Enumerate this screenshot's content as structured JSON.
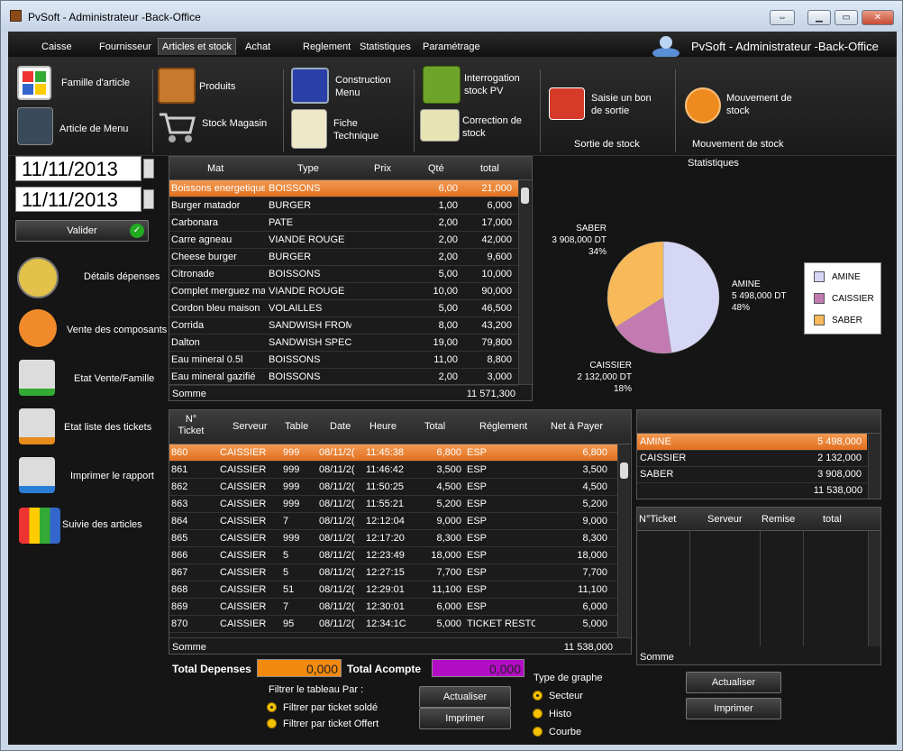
{
  "window": {
    "title": "PvSoft - Administrateur -Back-Office",
    "header_user": "PvSoft - Administrateur -Back-Office"
  },
  "menu": [
    "Caisse",
    "Fournisseur",
    "Articles et stock",
    "Achat",
    "Reglement",
    "Statistiques",
    "Paramétrage"
  ],
  "ribbon": {
    "famille": "Famille d'article",
    "article_menu": "Article de Menu",
    "produits": "Produits",
    "stock_magasin": "Stock Magasin",
    "construction_l1": "Construction",
    "construction_l2": "Menu",
    "fiche_l1": "Fiche",
    "fiche_l2": "Technique",
    "interrogation_l1": "Interrogation",
    "interrogation_l2": "stock PV",
    "correction_l1": "Correction de",
    "correction_l2": "stock",
    "saisie_l1": "Saisie un bon",
    "saisie_l2": "de sortie",
    "sortie_group": "Sortie de stock",
    "mouvement_l1": "Mouvement de",
    "mouvement_l2": "stock",
    "mouvement_group": "Mouvement de stock"
  },
  "dates": {
    "from": "11/11/2013",
    "to": "11/11/2013"
  },
  "valider": "Valider",
  "sidebar": [
    "Détails dépenses",
    "Vente des composants",
    "Etat Vente/Famille",
    "Etat liste des tickets",
    "Imprimer le rapport",
    "Suivie des articles"
  ],
  "articles": {
    "headers": [
      "Mat",
      "Type",
      "Prix",
      "Qté",
      "total"
    ],
    "rows": [
      [
        "Boissons energetique",
        "BOISSONS",
        "",
        "6,00",
        "21,000"
      ],
      [
        "Burger matador",
        "BURGER",
        "",
        "1,00",
        "6,000"
      ],
      [
        "Carbonara",
        "PATE",
        "",
        "2,00",
        "17,000"
      ],
      [
        "Carre agneau",
        "VIANDE ROUGE",
        "",
        "2,00",
        "42,000"
      ],
      [
        "Cheese burger",
        "BURGER",
        "",
        "2,00",
        "9,600"
      ],
      [
        "Citronade",
        "BOISSONS",
        "",
        "5,00",
        "10,000"
      ],
      [
        "Complet merguez ma",
        "VIANDE ROUGE",
        "",
        "10,00",
        "90,000"
      ],
      [
        "Cordon bleu maison",
        "VOLAILLES",
        "",
        "5,00",
        "46,500"
      ],
      [
        "Corrida",
        "SANDWISH FROMA(",
        "",
        "8,00",
        "43,200"
      ],
      [
        "Dalton",
        "SANDWISH SPECIAI",
        "",
        "19,00",
        "79,800"
      ],
      [
        "Eau mineral 0.5l",
        "BOISSONS",
        "",
        "11,00",
        "8,800"
      ],
      [
        "Eau mineral gazifié",
        "BOISSONS",
        "",
        "2,00",
        "3,000"
      ]
    ],
    "somme_label": "Somme",
    "somme": "11 571,300"
  },
  "stats": {
    "title": "Statistiques",
    "labels": [
      {
        "name": "SABER",
        "amount": "3 908,000 DT",
        "pct": "34%"
      },
      {
        "name": "AMINE",
        "amount": "5 498,000 DT",
        "pct": "48%"
      },
      {
        "name": "CAISSIER",
        "amount": "2 132,000 DT",
        "pct": "18%"
      }
    ],
    "legend": [
      "AMINE",
      "CAISSIER",
      "SABER"
    ]
  },
  "chart_data": {
    "type": "pie",
    "categories": [
      "AMINE",
      "CAISSIER",
      "SABER"
    ],
    "values": [
      5498,
      2132,
      3908
    ],
    "colors": [
      "#d6d6f5",
      "#c27ab0",
      "#f7b95a"
    ]
  },
  "tickets": {
    "headers": [
      "N° Ticket",
      "Serveur",
      "Table",
      "Date",
      "Heure",
      "Total",
      "Réglement",
      "Net à Payer"
    ],
    "rows": [
      [
        "860",
        "CAISSIER",
        "999",
        "08/11/2(",
        "11:45:38",
        "6,800",
        "ESP",
        "6,800"
      ],
      [
        "861",
        "CAISSIER",
        "999",
        "08/11/2(",
        "11:46:42",
        "3,500",
        "ESP",
        "3,500"
      ],
      [
        "862",
        "CAISSIER",
        "999",
        "08/11/2(",
        "11:50:25",
        "4,500",
        "ESP",
        "4,500"
      ],
      [
        "863",
        "CAISSIER",
        "999",
        "08/11/2(",
        "11:55:21",
        "5,200",
        "ESP",
        "5,200"
      ],
      [
        "864",
        "CAISSIER",
        "7",
        "08/11/2(",
        "12:12:04",
        "9,000",
        "ESP",
        "9,000"
      ],
      [
        "865",
        "CAISSIER",
        "999",
        "08/11/2(",
        "12:17:20",
        "8,300",
        "ESP",
        "8,300"
      ],
      [
        "866",
        "CAISSIER",
        "5",
        "08/11/2(",
        "12:23:49",
        "18,000",
        "ESP",
        "18,000"
      ],
      [
        "867",
        "CAISSIER",
        "5",
        "08/11/2(",
        "12:27:15",
        "7,700",
        "ESP",
        "7,700"
      ],
      [
        "868",
        "CAISSIER",
        "51",
        "08/11/2(",
        "12:29:01",
        "11,100",
        "ESP",
        "11,100"
      ],
      [
        "869",
        "CAISSIER",
        "7",
        "08/11/2(",
        "12:30:01",
        "6,000",
        "ESP",
        "6,000"
      ],
      [
        "870",
        "CAISSIER",
        "95",
        "08/11/2(",
        "12:34:1C",
        "5,000",
        "TICKET RESTO",
        "5,000"
      ]
    ],
    "somme_label": "Somme",
    "somme": "11 538,000"
  },
  "servers": {
    "rows": [
      [
        "AMINE",
        "5 498,000"
      ],
      [
        "CAISSIER",
        "2 132,000"
      ],
      [
        "SABER",
        "3 908,000"
      ]
    ],
    "total": "11 538,000"
  },
  "remises": {
    "headers": [
      "N°Ticket",
      "Serveur",
      "Remise",
      "total"
    ],
    "somme_label": "Somme"
  },
  "bottom": {
    "total_depenses_label": "Total Depenses",
    "total_depenses": "0,000",
    "total_acompte_label": "Total Acompte",
    "total_acompte": "0,000",
    "filtrer_label": "Filtrer le tableau Par :",
    "filtre1": "Filtrer par ticket soldé",
    "filtre2": "Filtrer par ticket Offert",
    "actualiser": "Actualiser",
    "imprimer": "Imprimer",
    "type_graphe": "Type de graphe",
    "secteur": "Secteur",
    "histo": "Histo",
    "courbe": "Courbe",
    "actualiser2": "Actualiser",
    "imprimer2": "Imprimer"
  }
}
